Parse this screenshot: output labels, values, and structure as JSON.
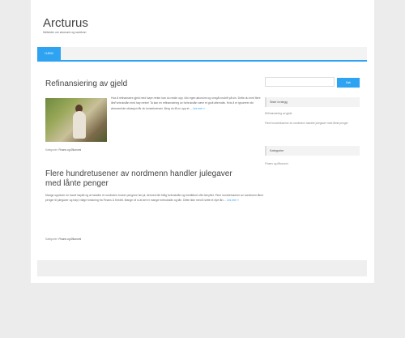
{
  "site": {
    "title": "Arcturus",
    "description": "Nettsider om økonomi og samfunn"
  },
  "nav": {
    "home_label": "Hjem"
  },
  "posts": [
    {
      "title": "Refinansiering av gjeld",
      "excerpt": "Hva å refinansiere gjeld med høye renter kan du redde opp i din egen økonomi og unngå rovdrift på sin. Dette du med flere lånForbrukslån med høy renter! Ta kan en refinansiering av forbrukslån være et godt alternativ. Hvis å er ignorerer din økonomiske situasjon får du konsekvenser. Berg du få nu opp et…",
      "read_more": "Les mer »",
      "meta_prefix": "Kategorier:",
      "category": "Finans og Økonomi"
    },
    {
      "title": "Flere hundretusener av nordmenn handler julegaver med lånte penger",
      "excerpt": "Mange opplever en travel høytid og at handler et nordmenn bruker pengene før jul, dermed blir billig forbrukslån og kredittkort ofte benyttet. Flere hundretusener av nordmenn låner penger til julegaver og høyt i følge forskning fra Finans & Kreditt. Mange vil si at det er mange forbrukslån og lån. Dette ikke med å sette et dyrt lån…",
      "read_more": "Les mer »",
      "meta_prefix": "Kategorier:",
      "category": "Finans og Økonomi"
    }
  ],
  "sidebar": {
    "search_button": "Søk",
    "recent_title": "Siste innlegg",
    "recent_posts": [
      "Refinansiering av gjeld",
      "Flere hundretusener av nordmenn handler julegaver med lånte penger"
    ],
    "categories_title": "Kategorier",
    "categories": [
      "Finans og Økonomi"
    ]
  },
  "colors": {
    "accent": "#2ea3f2",
    "page_bg": "#ececec"
  }
}
